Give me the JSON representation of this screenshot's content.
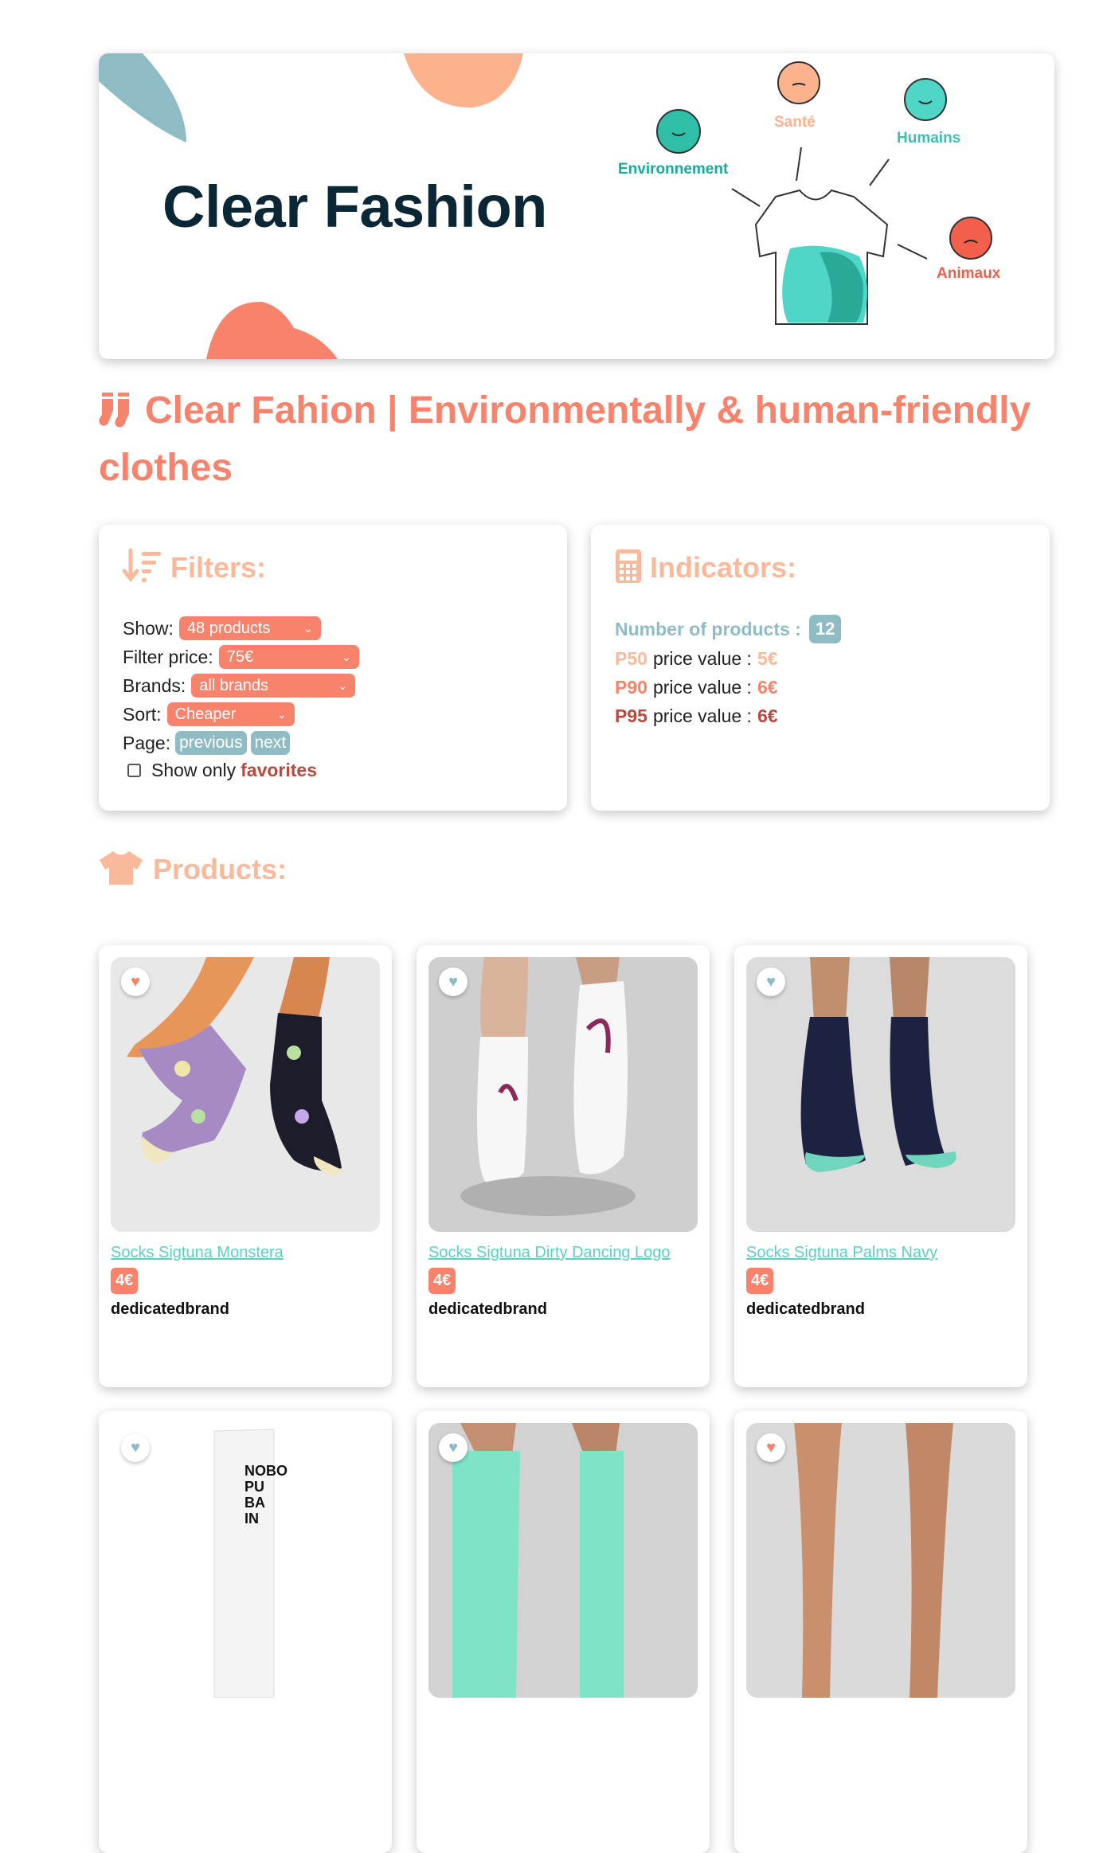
{
  "banner": {
    "title": "Clear Fashion",
    "labels": {
      "environment": "Environnement",
      "health": "Santé",
      "humans": "Humains",
      "animals": "Animaux"
    }
  },
  "page_title": "Clear Fahion | Environmentally & human-friendly clothes",
  "filters": {
    "title": "Filters:",
    "show_label": "Show:",
    "show_value": "48 products",
    "price_label": "Filter price:",
    "price_value": "75€",
    "brands_label": "Brands:",
    "brands_value": "all brands",
    "sort_label": "Sort:",
    "sort_value": "Cheaper",
    "page_label": "Page:",
    "previous": "previous",
    "next": "next",
    "favorites_prefix": "Show only",
    "favorites_word": "favorites",
    "favorites_checked": false
  },
  "indicators": {
    "title": "Indicators:",
    "count_label": "Number of products :",
    "count_value": "12",
    "p50_key": "P50",
    "p90_key": "P90",
    "p95_key": "P95",
    "price_value_label": "price value :",
    "p50_value": "5€",
    "p90_value": "6€",
    "p95_value": "6€"
  },
  "products_title": "Products:",
  "products": [
    {
      "name": "Socks Sigtuna Monstera",
      "price": "4€",
      "brand": "dedicatedbrand",
      "favorite": true
    },
    {
      "name": "Socks Sigtuna Dirty Dancing Logo",
      "price": "4€",
      "brand": "dedicatedbrand",
      "favorite": false
    },
    {
      "name": "Socks Sigtuna Palms Navy",
      "price": "4€",
      "brand": "dedicatedbrand",
      "favorite": false
    },
    {
      "name": "",
      "price": "",
      "brand": "",
      "favorite": false,
      "image_text": "NOBO\nPU\nBA\nIN"
    },
    {
      "name": "",
      "price": "",
      "brand": "",
      "favorite": false
    },
    {
      "name": "",
      "price": "",
      "brand": "",
      "favorite": true
    }
  ],
  "colors": {
    "accent": "#f7836c",
    "peach": "#f9b99a",
    "teal": "#5ad1c1",
    "slate": "#8fbcc4",
    "dark_red": "#b74a3e",
    "navy": "#0b2634"
  },
  "icons": [
    "socks-icon",
    "filter-sort-icon",
    "calculator-icon",
    "tshirt-icon",
    "heart-icon",
    "chevron-down-icon"
  ]
}
